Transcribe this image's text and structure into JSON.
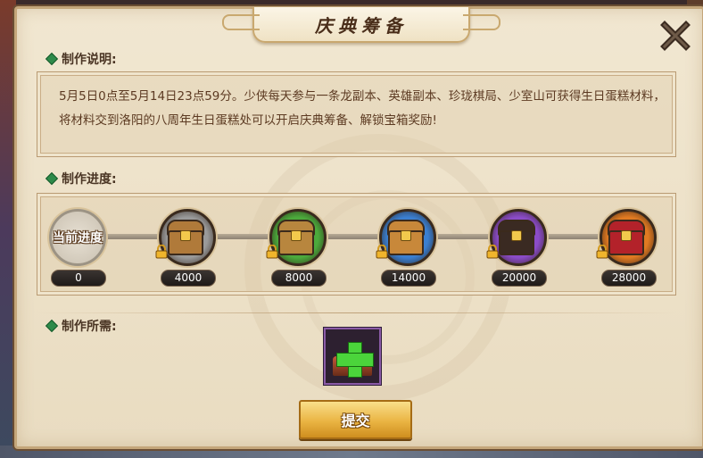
{
  "title": "庆典筹备",
  "close_icon": "close-icon",
  "sections": {
    "description_label": "制作说明:",
    "progress_label": "制作进度:",
    "requirements_label": "制作所需:"
  },
  "description": "5月5日0点至5月14日23点59分。少侠每天参与一条龙副本、英雄副本、珍珑棋局、少室山可获得生日蛋糕材料，将材料交到洛阳的八周年生日蛋糕处可以开启庆典筹备、解锁宝箱奖励!",
  "progress": {
    "current_label": "当前进度",
    "current_value": "0",
    "fill_fraction": 0.0,
    "milestones": [
      {
        "value": "4000",
        "chest": "wooden",
        "locked": true,
        "ring_color": "#9a9a9a",
        "chest_color": "#b07a3a"
      },
      {
        "value": "8000",
        "chest": "green",
        "locked": true,
        "ring_color": "#4caa3c",
        "chest_color": "#b8863e"
      },
      {
        "value": "14000",
        "chest": "blue",
        "locked": true,
        "ring_color": "#3b7fd0",
        "chest_color": "#c8883a"
      },
      {
        "value": "20000",
        "chest": "purple",
        "locked": true,
        "ring_color": "#8b4cc7",
        "chest_color": "#3a2a22"
      },
      {
        "value": "28000",
        "chest": "orange",
        "locked": true,
        "ring_color": "#e07a22",
        "chest_color": "#b3222a"
      }
    ]
  },
  "requirement": {
    "item_icon": "birthday-cake-material-icon",
    "action_icon": "plus-icon",
    "border_color": "#8a5aa6"
  },
  "submit_label": "提交"
}
